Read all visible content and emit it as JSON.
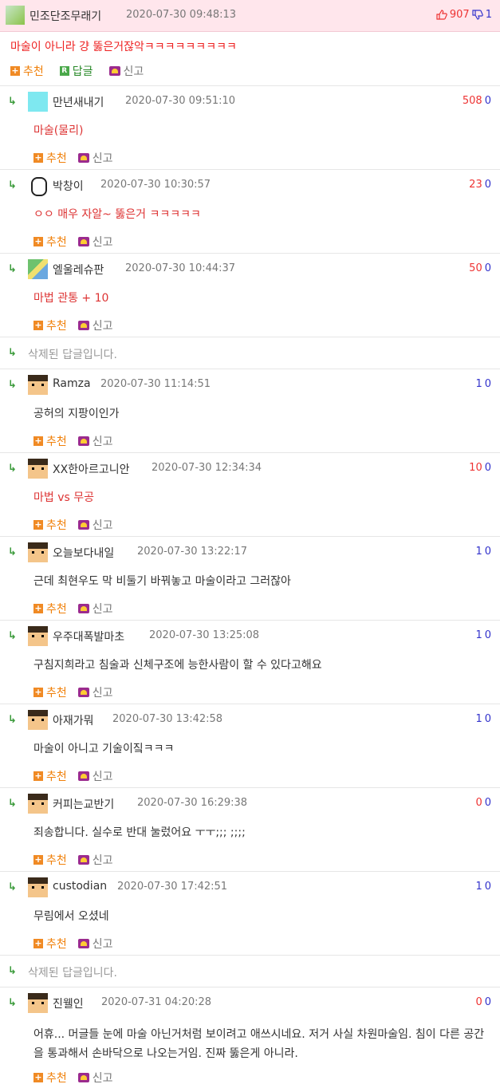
{
  "main": {
    "nick": "민조단조무래기",
    "date": "2020-07-30 09:48:13",
    "up": "907",
    "down": "1",
    "text": "마술이 아니라 걍 뚫은거잖악ㅋㅋㅋㅋㅋㅋㅋㅋㅋ",
    "recommend": "추천",
    "reply": "답글",
    "report": "신고"
  },
  "comments": [
    {
      "nick": "만년새내기",
      "date": "2020-07-30 09:51:10",
      "up": "508",
      "down": "0",
      "text": "마술(물리)"
    },
    {
      "nick": "박창이",
      "date": "2020-07-30 10:30:57",
      "up": "23",
      "down": "0",
      "text": "ㅇㅇ 매우 자알~ 뚫은거 ㅋㅋㅋㅋㅋ"
    },
    {
      "nick": "엘울레슈판",
      "date": "2020-07-30 10:44:37",
      "up": "50",
      "down": "0",
      "text": "마법 관통 + 10"
    },
    {
      "deleted": "삭제된 답글입니다."
    },
    {
      "nick": "Ramza",
      "date": "2020-07-30 11:14:51",
      "up": "1",
      "down": "0",
      "text": "공허의 지팡이인가"
    },
    {
      "nick": "XX한아르고니안",
      "date": "2020-07-30 12:34:34",
      "up": "10",
      "down": "0",
      "text": "마법 vs 무공"
    },
    {
      "nick": "오늘보다내일",
      "date": "2020-07-30 13:22:17",
      "up": "1",
      "down": "0",
      "text": "근데 최현우도 막 비둘기 바꿔놓고 마술이라고 그러잖아"
    },
    {
      "nick": "우주대폭발마초",
      "date": "2020-07-30 13:25:08",
      "up": "1",
      "down": "0",
      "text": "구침지희라고 침술과 신체구조에 능한사람이 할 수 있다고해요"
    },
    {
      "nick": "아재가뭐",
      "date": "2020-07-30 13:42:58",
      "up": "1",
      "down": "0",
      "text": "마술이 아니고 기술이짘ㅋㅋㅋ"
    },
    {
      "nick": "커피는교반기",
      "date": "2020-07-30 16:29:38",
      "up": "0",
      "down": "0",
      "text": "죄송합니다. 실수로 반대 눌렀어요 ㅜㅜ;;; ;;;;"
    },
    {
      "nick": "custodian",
      "date": "2020-07-30 17:42:51",
      "up": "1",
      "down": "0",
      "text": "무림에서 오셨네"
    },
    {
      "deleted": "삭제된 답글입니다."
    },
    {
      "nick": "진웰인",
      "date": "2020-07-31 04:20:28",
      "up": "0",
      "down": "0",
      "text": "어휴... 머글들 눈에 마술 아닌거처럼 보이려고 애쓰시네요. 저거 사실 차원마술임. 침이 다른 공간을 통과해서 손바닥으로 나오는거임. 진짜 뚫은게 아니라."
    }
  ],
  "labels": {
    "recommend": "추천",
    "report": "신고"
  },
  "icons": {
    "reply_arrow": "reply-arrow-icon",
    "thumb_up": "thumb-up-icon",
    "thumb_down": "thumb-down-icon",
    "recommend": "plus-icon",
    "report": "siren-icon"
  },
  "colors": {
    "header_bg": "#ffe6ec",
    "up": "#e33",
    "down": "#33c",
    "red_text": "#d33"
  }
}
